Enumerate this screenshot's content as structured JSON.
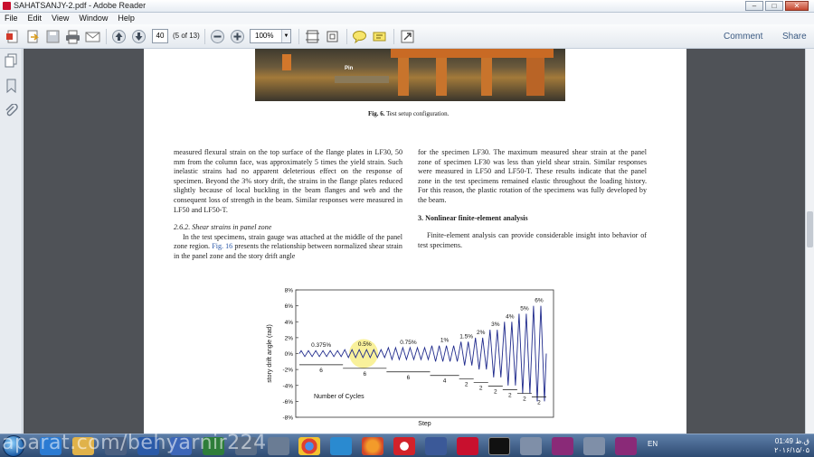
{
  "window": {
    "title": "SAHATSANJY-2.pdf - Adobe Reader",
    "controls": {
      "minimize": "–",
      "maximize": "□",
      "close": "✕"
    }
  },
  "menu": [
    "File",
    "Edit",
    "View",
    "Window",
    "Help"
  ],
  "toolbar": {
    "icons": [
      "create-icon",
      "export-icon",
      "save-icon",
      "print-icon",
      "email-icon",
      "prev-page-icon",
      "next-page-icon",
      "zoom-out-icon",
      "zoom-in-icon",
      "fit-page-icon",
      "fit-width-icon",
      "comment-bubble-icon",
      "highlight-icon",
      "fullscreen-icon"
    ],
    "page_number": "40",
    "page_count": "(5 of 13)",
    "zoom": "100%",
    "comment_label": "Comment",
    "share_label": "Share"
  },
  "colors": {
    "accent": "#3b5a82",
    "doc_bg": "#4f5257",
    "taskbar": "#2e4b72",
    "series": "#1f2a8c"
  },
  "document": {
    "photo_label": "Pin",
    "caption_fig": "Fig. 6.",
    "caption_text": "Test setup configuration.",
    "left_para": "measured flexural strain on the top surface of the flange plates in LF30, 50 mm from the column face, was approximately 5 times the yield strain. Such inelastic strains had no apparent deleterious effect on the response of specimen. Beyond the 3% story drift, the strains in the flange plates reduced slightly because of local buckling in the beam flanges and web and the consequent loss of strength in the beam. Similar responses were measured in LF50 and LF50-T.",
    "left_subhead": "2.6.2. Shear strains in panel zone",
    "left_para2_a": "In the test specimens, strain gauge was attached at the middle of the panel zone region.",
    "left_para2_link": "Fig. 16",
    "left_para2_b": "presents the relationship between normalized shear strain in the panel zone and the story drift angle",
    "right_para": "for the specimen LF30. The maximum measured shear strain at the panel zone of specimen LF30 was less than yield shear strain. Similar responses were measured in LF50 and LF50-T. These results indicate that the panel zone in the test specimens remained elastic throughout the loading history. For this reason, the plastic rotation of the specimens was fully developed by the beam.",
    "right_head": "3. Nonlinear finite-element analysis",
    "right_para2": "Finite-element analysis can provide considerable insight into behavior of test specimens."
  },
  "chart_data": {
    "type": "line",
    "title": "",
    "xlabel": "Step",
    "ylabel": "story drift angle (rad)",
    "y_ticks": [
      "8%",
      "6%",
      "4%",
      "2%",
      "0%",
      "-2%",
      "-4%",
      "-6%",
      "-8%"
    ],
    "ylim": [
      -8,
      8
    ],
    "grid": false,
    "series": [
      {
        "amplitudes": [
          0.375,
          0.5,
          0.75,
          1,
          1.5,
          2,
          3,
          4,
          5,
          6
        ],
        "cycles": [
          6,
          6,
          6,
          4,
          2,
          2,
          2,
          2,
          2,
          2
        ]
      }
    ],
    "amplitude_labels": [
      "0.375%",
      "0.5%",
      "0.75%",
      "1%",
      "1.5%",
      "2%",
      "3%",
      "4%",
      "5%",
      "6%"
    ],
    "cycle_labels": [
      "6",
      "6",
      "6",
      "4",
      "2",
      "2",
      "2",
      "2",
      "2",
      "2"
    ],
    "annotation": "Number of Cycles"
  },
  "taskbar": {
    "apps": [
      "start-orb",
      "ie-icon",
      "explorer-icon",
      "media-icon",
      "word-icon",
      "media-player-icon",
      "excel-icon",
      "chrome-icon",
      "sharing-icon",
      "firefox-icon",
      "opera-icon",
      "facebook-icon",
      "acrobat-icon",
      "cmd-icon",
      "app-icon",
      "video-icon",
      "app-icon-2",
      "video-icon-2"
    ],
    "lang": "EN",
    "time": "01:49 ق.ظ",
    "date": "۲۰۱۶/۱۵/۰۵",
    "watermark": "aparat.com/behyarnir224"
  }
}
